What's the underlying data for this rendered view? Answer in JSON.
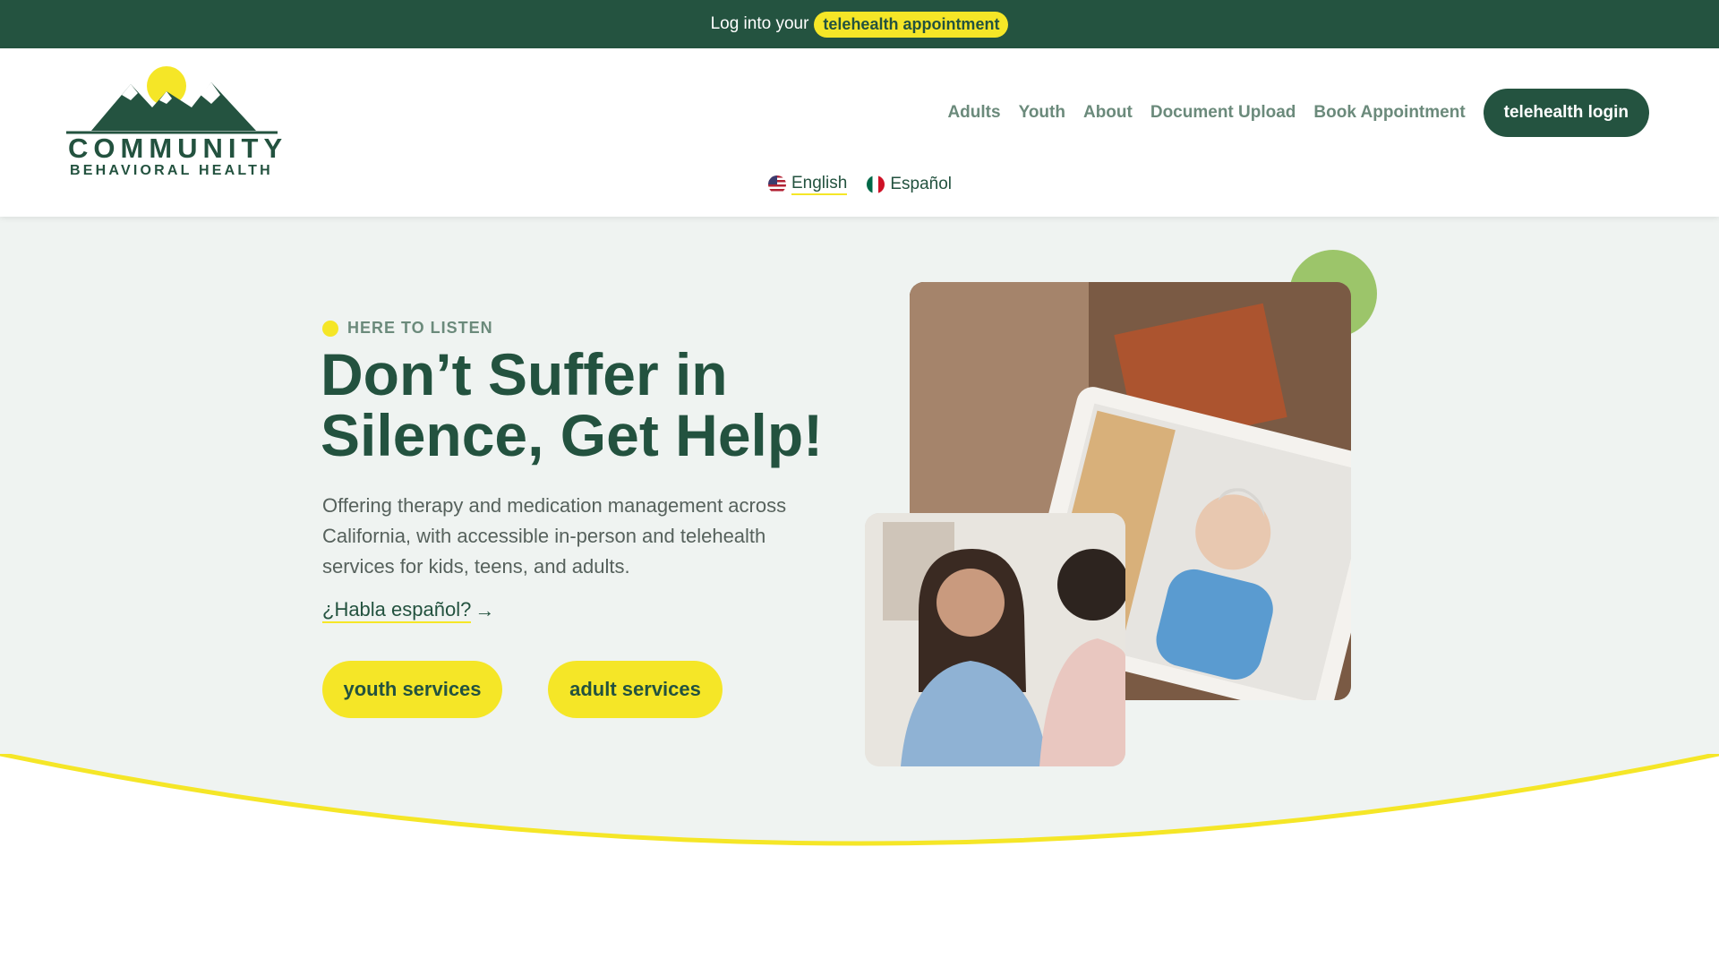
{
  "announcement": {
    "prefix": "Log into your",
    "link": "telehealth appointment"
  },
  "logo": {
    "line1": "COMMUNITY",
    "line2": "BEHAVIORAL HEALTH"
  },
  "nav": {
    "items": [
      "Adults",
      "Youth",
      "About",
      "Document Upload",
      "Book Appointment"
    ],
    "cta": "telehealth login"
  },
  "languages": [
    {
      "label": "English",
      "flag": "us-flag-icon",
      "active": true
    },
    {
      "label": "Español",
      "flag": "mexico-flag-icon",
      "active": false
    }
  ],
  "hero": {
    "eyebrow": "HERE TO LISTEN",
    "headline": "Don’t Suffer in Silence, Get Help!",
    "body": "Offering therapy and medication management across California, with accessible in-person and telehealth services for kids, teens, and adults.",
    "spanish_link": "¿Habla español?",
    "spanish_arrow": "→",
    "buttons": [
      "youth services",
      "adult services"
    ]
  },
  "colors": {
    "brand_green": "#245340",
    "accent_yellow": "#f5e627",
    "accent_light_green": "#9cc56a",
    "hero_bg": "#eff3f1"
  }
}
